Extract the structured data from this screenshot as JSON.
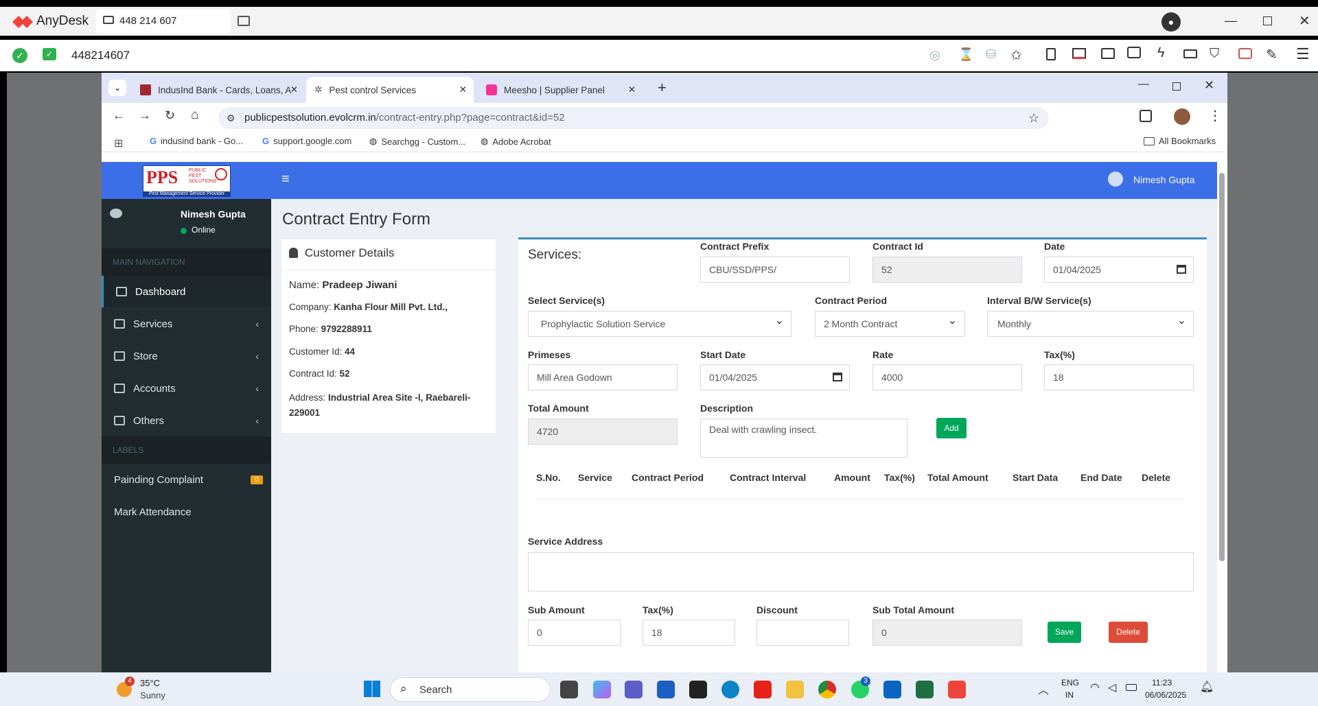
{
  "anydesk": {
    "app_name": "AnyDesk",
    "session_id": "448 214 607",
    "address": "448214607"
  },
  "browser": {
    "tabs": [
      {
        "label": "IndusInd Bank - Cards, Loans, A"
      },
      {
        "label": "Pest control Services"
      },
      {
        "label": "Meesho | Supplier Panel"
      }
    ],
    "url_host": "publicpestsolution.evolcrm.in",
    "url_path": "/contract-entry.php?page=contract&id=52",
    "bookmarks": [
      "indusind bank - Go...",
      "support.google.com",
      "Searchgg - Custom...",
      "Adobe Acrobat"
    ],
    "all_bookmarks": "All Bookmarks"
  },
  "app": {
    "logo_text": "PPS",
    "logo_small": [
      "PUBLIC",
      "PEST",
      "SOLUTIONS"
    ],
    "logo_sub": "Pest Management Service Provider",
    "user_name": "Nimesh Gupta",
    "user_status": "Online"
  },
  "sidebar": {
    "main_header": "MAIN NAVIGATION",
    "items": [
      {
        "label": "Dashboard"
      },
      {
        "label": "Services"
      },
      {
        "label": "Store"
      },
      {
        "label": "Accounts"
      },
      {
        "label": "Others"
      }
    ],
    "labels_header": "LABELS",
    "label_items": [
      {
        "label": "Painding Complaint",
        "badge": "0"
      },
      {
        "label": "Mark Attendance"
      }
    ]
  },
  "page": {
    "title": "Contract Entry Form"
  },
  "customer": {
    "heading": "Customer Details",
    "name_label": "Name:",
    "name": "Pradeep Jiwani",
    "company_label": "Company:",
    "company": "Kanha Flour Mill Pvt. Ltd.,",
    "phone_label": "Phone:",
    "phone": "9792288911",
    "customer_id_label": "Customer Id:",
    "customer_id": "44",
    "contract_id_label": "Contract Id:",
    "contract_id": "52",
    "address_label": "Address:",
    "address": "Industrial Area Site -I, Raebareli-229001"
  },
  "form": {
    "section_title": "Services:",
    "contract_prefix_label": "Contract Prefix",
    "contract_prefix": "CBU/SSD/PPS/",
    "contract_id_label": "Contract Id",
    "contract_id": "52",
    "date_label": "Date",
    "date": "01/04/2025",
    "service_label": "Select Service(s)",
    "service": "Prophylactic Solution Service",
    "period_label": "Contract Period",
    "period": "2 Month Contract",
    "interval_label": "Interval B/W Service(s)",
    "interval": "Monthly",
    "premises_label": "Primeses",
    "premises": "Mill Area Godown",
    "start_date_label": "Start Date",
    "start_date": "01/04/2025",
    "rate_label": "Rate",
    "rate": "4000",
    "tax_label": "Tax(%)",
    "tax": "18",
    "total_label": "Total Amount",
    "total": "4720",
    "description_label": "Description",
    "description": "Deal with crawling insect.",
    "add_button": "Add",
    "table_headers": [
      "S.No.",
      "Service",
      "Contract Period",
      "Contract Interval",
      "Amount",
      "Tax(%)",
      "Total Amount",
      "Start Data",
      "End Date",
      "Delete"
    ],
    "service_address_label": "Service Address",
    "sub_amount_label": "Sub Amount",
    "sub_amount": "0",
    "sub_tax_label": "Tax(%)",
    "sub_tax": "18",
    "discount_label": "Discount",
    "sub_total_label": "Sub Total Amount",
    "sub_total": "0",
    "save_button": "Save",
    "delete_button": "Delete"
  },
  "taskbar": {
    "weather_temp": "35°C",
    "weather_desc": "Sunny",
    "weather_badge": "4",
    "search": "Search",
    "lang": "ENG",
    "region": "IN",
    "time": "11:23",
    "date": "06/06/2025",
    "whatsapp_badge": "3"
  },
  "colors": {
    "topnav": "#3c6ee8",
    "sidebar": "#222d32",
    "add_button": "#00a65a",
    "delete_button": "#dd4b39",
    "badge": "#f39c12"
  }
}
